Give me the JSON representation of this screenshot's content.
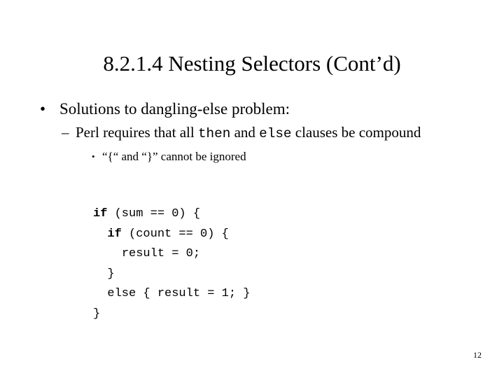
{
  "slide": {
    "title": "8.2.1.4 Nesting Selectors (Cont’d)",
    "page_number": "12",
    "background_color": "#ffffff",
    "text_color": "#000000"
  },
  "outline": {
    "level1": {
      "marker": "•",
      "text": "Solutions to dangling-else problem:"
    },
    "level2": {
      "marker": "–",
      "part1": "Perl requires that all ",
      "code1": "then",
      "part2": " and ",
      "code2": "else",
      "part3": " clauses be compound"
    },
    "level3": {
      "marker": "•",
      "text": "“{“ and “}” cannot be ignored"
    }
  },
  "code": {
    "lines": [
      {
        "keyword": "if",
        "rest": " (sum == 0) {",
        "indent": ""
      },
      {
        "keyword": "if",
        "rest": " (count == 0) {",
        "indent": "  "
      },
      {
        "keyword": "",
        "rest": "result = 0;",
        "indent": "    "
      },
      {
        "keyword": "",
        "rest": "}",
        "indent": "  "
      },
      {
        "keyword": "",
        "rest": "else { result = 1; }",
        "indent": "  "
      },
      {
        "keyword": "",
        "rest": "}",
        "indent": ""
      }
    ]
  }
}
